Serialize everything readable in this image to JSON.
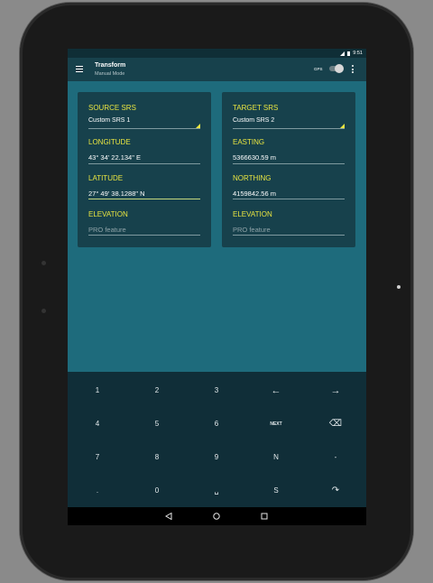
{
  "statusbar": {
    "time": "9:51"
  },
  "appbar": {
    "title": "Transform",
    "subtitle": "Manual Mode",
    "gps_label": "GPS"
  },
  "source": {
    "header": "SOURCE SRS",
    "srs_value": "Custom SRS 1",
    "longitude_label": "LONGITUDE",
    "longitude_value": "43° 34' 22.134\" E",
    "latitude_label": "LATITUDE",
    "latitude_value": "27° 49' 38.1288\" N",
    "elevation_label": "ELEVATION",
    "elevation_hint": "PRO feature"
  },
  "target": {
    "header": "TARGET SRS",
    "srs_value": "Custom SRS 2",
    "easting_label": "EASTING",
    "easting_value": "5366630.59 m",
    "northing_label": "NORTHING",
    "northing_value": "4159842.56 m",
    "elevation_label": "ELEVATION",
    "elevation_hint": "PRO feature"
  },
  "keyboard": {
    "row1": [
      "1",
      "2",
      "3",
      "←",
      "→"
    ],
    "row2": [
      "4",
      "5",
      "6",
      "NEXT",
      "⌫"
    ],
    "row3": [
      "7",
      "8",
      "9",
      "N",
      "-"
    ],
    "row4": [
      ".",
      "0",
      "␣",
      "S",
      "↷"
    ]
  },
  "icons": {
    "menu": "menu-icon",
    "overflow": "overflow-menu-icon",
    "back": "back-triangle-icon",
    "home": "home-circle-icon",
    "recents": "recents-square-icon"
  }
}
